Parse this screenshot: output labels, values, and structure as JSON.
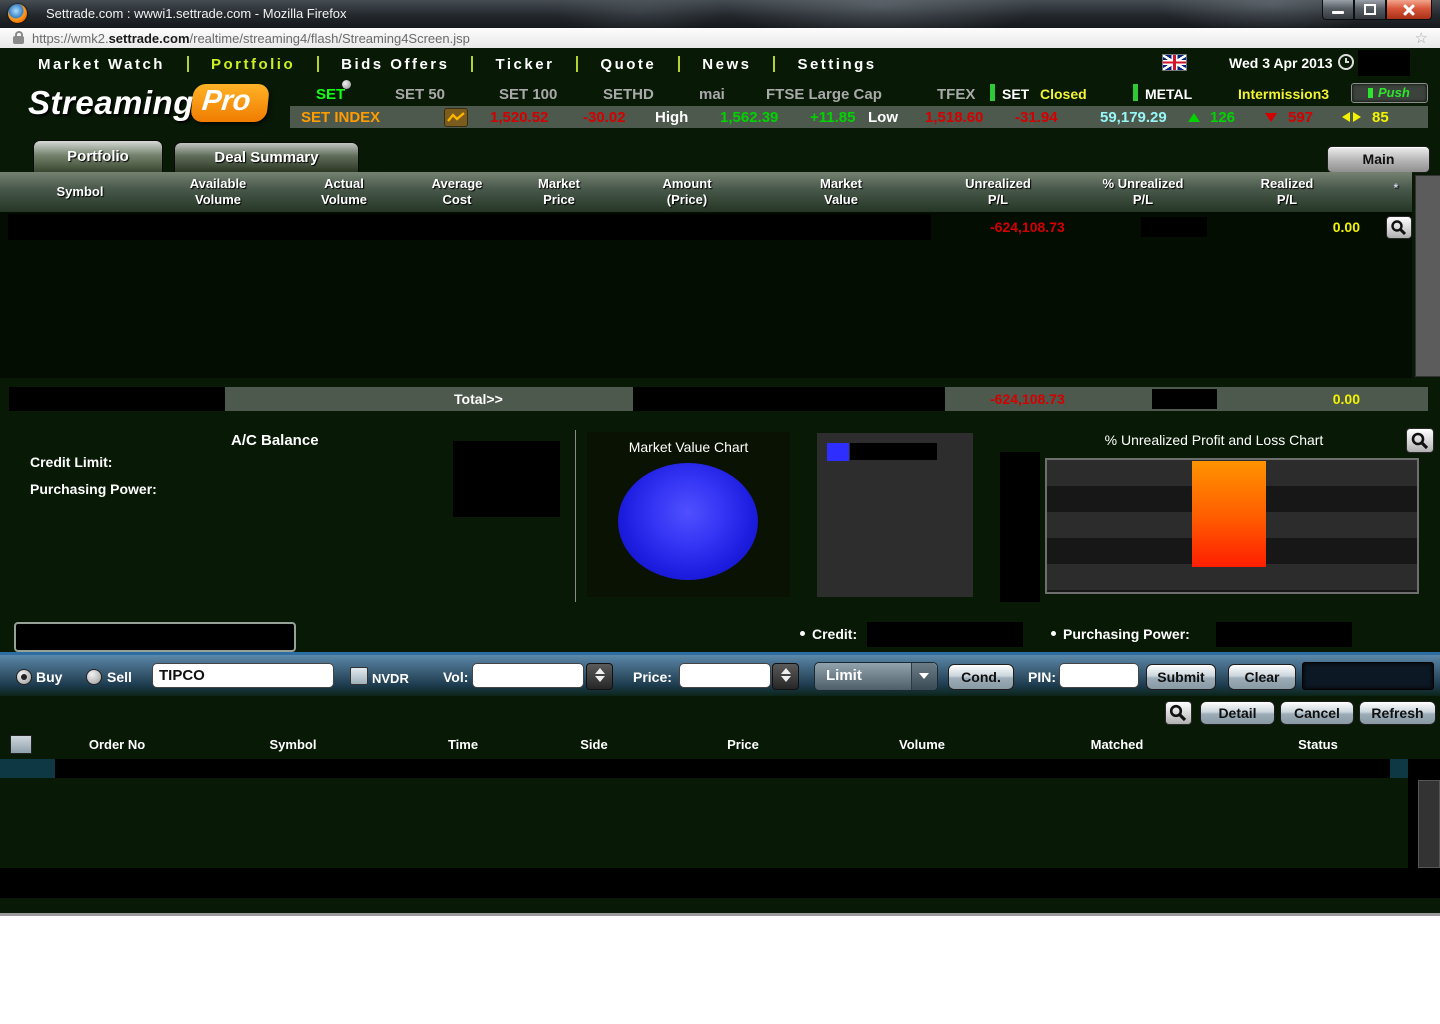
{
  "browser": {
    "title": "Settrade.com : wwwi1.settrade.com - Mozilla Firefox",
    "url_prefix": "https://wmk2.",
    "url_domain": "settrade.com",
    "url_path": "/realtime/streaming4/flash/Streaming4Screen.jsp"
  },
  "icons": {
    "star": "☆"
  },
  "nav": {
    "items": [
      "Market Watch",
      "Portfolio",
      "Bids Offers",
      "Ticker",
      "Quote",
      "News",
      "Settings"
    ],
    "date": "Wed 3 Apr 2013"
  },
  "logo": {
    "streaming": "Streaming",
    "pro": "Pro"
  },
  "index_tabs": {
    "set": "SET",
    "set50": "SET 50",
    "set100": "SET 100",
    "sethd": "SETHD",
    "mai": "mai",
    "ftse": "FTSE Large Cap",
    "tfex": "TFEX"
  },
  "market_status": {
    "set": "SET",
    "set_state": "Closed",
    "metal": "METAL",
    "session": "Intermission3",
    "push": "Push"
  },
  "ticker": {
    "name": "SET INDEX",
    "last": "1,520.52",
    "change": "-30.02",
    "high_label": "High",
    "high": "1,562.39",
    "high_change": "+11.85",
    "low_label": "Low",
    "low": "1,518.60",
    "low_change": "-31.94",
    "total_value": "59,179.29",
    "advances": "126",
    "declines": "597",
    "unchanged": "85"
  },
  "portfolio": {
    "tab_portfolio": "Portfolio",
    "tab_deal_summary": "Deal Summary",
    "main_button": "Main",
    "columns": [
      "Symbol",
      "Available\nVolume",
      "Actual\nVolume",
      "Average\nCost",
      "Market\nPrice",
      "Amount\n(Price)",
      "Market\nValue",
      "Unrealized\nP/L",
      "% Unrealized\nP/L",
      "Realized\nP/L",
      "*"
    ],
    "row1": {
      "unrealized_pl": "-624,108.73",
      "realized_pl": "0.00"
    },
    "total": {
      "label": "Total>>",
      "unrealized_pl": "-624,108.73",
      "realized_pl": "0.00"
    }
  },
  "account": {
    "title": "A/C Balance",
    "credit_limit_label": "Credit Limit:",
    "purchasing_power_label": "Purchasing Power:"
  },
  "charts": {
    "market_value_title": "Market Value Chart",
    "pl_title": "% Unrealized Profit and Loss Chart"
  },
  "chart_data": [
    {
      "type": "pie",
      "title": "Market Value Chart",
      "series": [
        {
          "name": "redacted",
          "value": 100
        }
      ],
      "colors": [
        "#2a2aee"
      ],
      "note": "single blue slice fills entire pie; legend label redacted"
    },
    {
      "type": "bar",
      "title": "% Unrealized Profit and Loss Chart",
      "categories": [
        "redacted"
      ],
      "values": [
        null
      ],
      "bar_color": "#ff4400",
      "note": "single orange-to-red vertical bar near centre; axis tick labels redacted"
    }
  ],
  "summary_row": {
    "credit_label": "Credit:",
    "purchasing_power_label": "Purchasing Power:"
  },
  "order_entry": {
    "buy": "Buy",
    "sell": "Sell",
    "selected_side": "Buy",
    "symbol_value": "TIPCO",
    "nvdr": "NVDR",
    "vol_label": "Vol:",
    "vol_value": "",
    "price_label": "Price:",
    "price_value": "",
    "order_type": "Limit",
    "cond": "Cond.",
    "pin_label": "PIN:",
    "pin_value": "",
    "submit": "Submit",
    "clear": "Clear"
  },
  "order_actions": {
    "detail": "Detail",
    "cancel": "Cancel",
    "refresh": "Refresh"
  },
  "orders": {
    "columns": [
      "Order No",
      "Symbol",
      "Time",
      "Side",
      "Price",
      "Volume",
      "Matched",
      "Status"
    ]
  }
}
